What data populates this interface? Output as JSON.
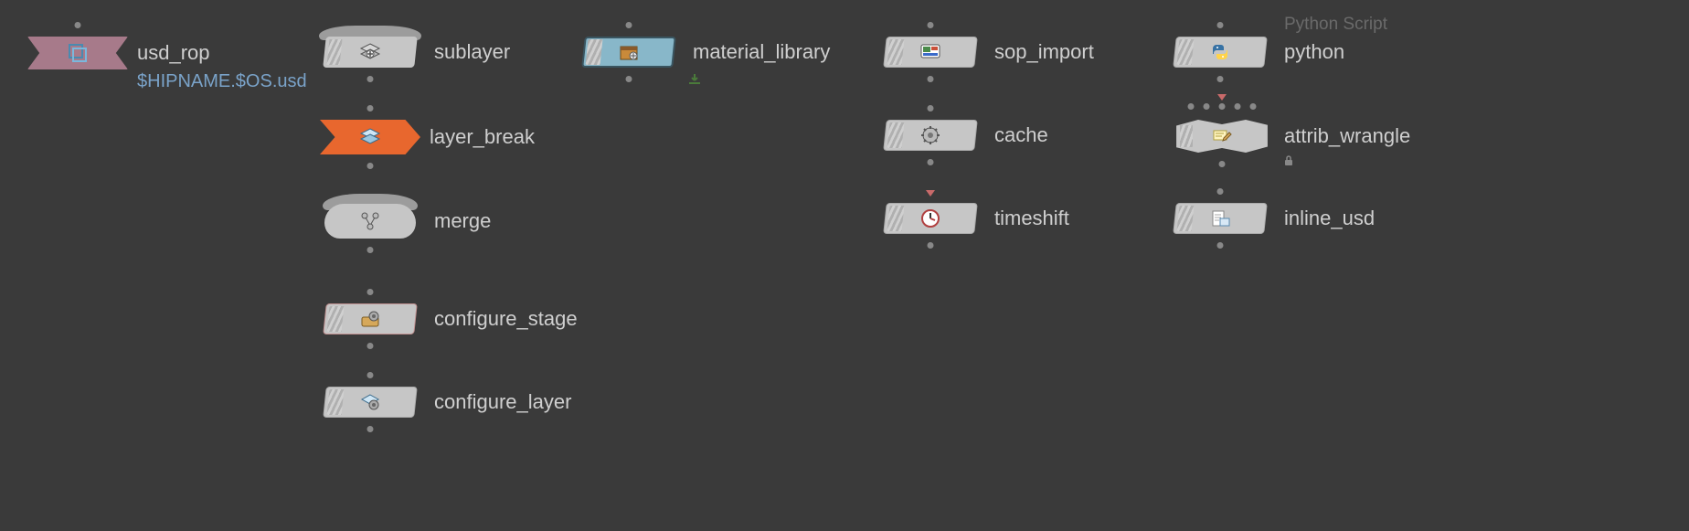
{
  "nodes": {
    "usd_rop": {
      "label": "usd_rop",
      "sublabel": "$HIPNAME.$OS.usd",
      "icon": "usd-rop"
    },
    "sublayer": {
      "label": "sublayer",
      "icon": "sublayer"
    },
    "layer_break": {
      "label": "layer_break",
      "icon": "layerbreak"
    },
    "merge": {
      "label": "merge",
      "icon": "merge"
    },
    "configure_stage": {
      "label": "configure_stage",
      "icon": "configure-stage"
    },
    "configure_layer": {
      "label": "configure_layer",
      "icon": "configure-layer"
    },
    "material_library": {
      "label": "material_library",
      "icon": "material",
      "badge": "download"
    },
    "sop_import": {
      "label": "sop_import",
      "icon": "sop-import"
    },
    "cache": {
      "label": "cache",
      "icon": "gear"
    },
    "timeshift": {
      "label": "timeshift",
      "icon": "clock",
      "marker": "red"
    },
    "python": {
      "label": "python",
      "icon": "python",
      "comment": "Python Script"
    },
    "attrib_wrangle": {
      "label": "attrib_wrangle",
      "icon": "wrangle",
      "badge": "lock",
      "multi_in": 5
    },
    "inline_usd": {
      "label": "inline_usd",
      "icon": "inline-usd"
    }
  },
  "colors": {
    "canvas_bg": "#3a3a3a",
    "node_default": "#c6c6c6",
    "node_rop": "#a77a8a",
    "node_arrow": "#e8672e",
    "node_selected": "#88b7c9",
    "label": "#cfcfcf",
    "sublabel": "#7aa3c9",
    "comment": "#6a6a6a"
  }
}
